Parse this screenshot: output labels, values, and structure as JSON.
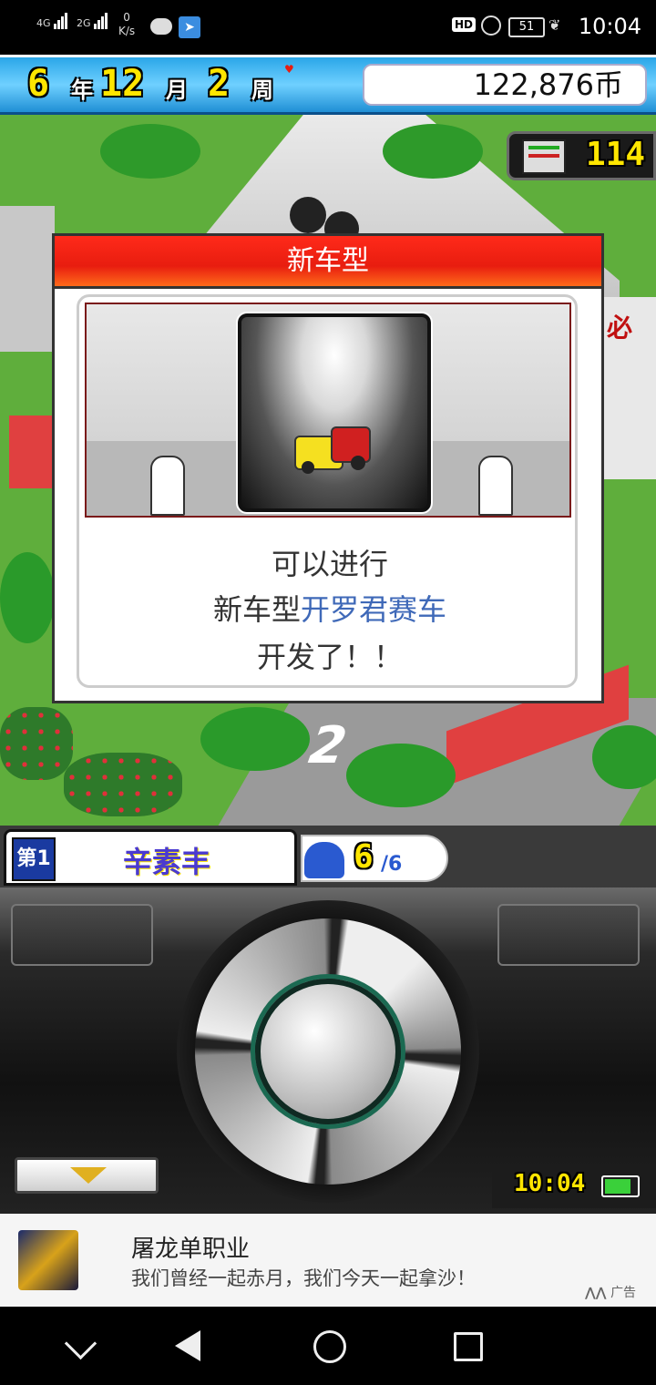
{
  "status_bar": {
    "net1": "4G",
    "net2": "2G",
    "speed_value": "0",
    "speed_unit": "K/s",
    "hd": "HD",
    "battery": "51",
    "time": "10:04"
  },
  "topbar": {
    "year_num": "6",
    "year_label": "年",
    "month_num": "12",
    "month_label": "月",
    "week_num": "2",
    "week_label": "周",
    "money": "122,876币"
  },
  "monitor": {
    "value": "114"
  },
  "dialog": {
    "title": "新车型",
    "line1": "可以进行",
    "line2_prefix": "新车型",
    "line2_highlight": "开罗君赛车",
    "line3": "开发了！！"
  },
  "staff": {
    "badge": "第1",
    "name": "辛素丰",
    "count": "6",
    "total": "/6"
  },
  "controller": {
    "clock": "10:04"
  },
  "ad": {
    "title": "屠龙单职业",
    "subtitle": "我们曾经一起赤月，我们今天一起拿沙！",
    "label": "广告"
  },
  "colors": {
    "accent_red": "#e81d0f",
    "highlight_blue": "#3f69b8",
    "topbar_blue": "#2aa6e8"
  }
}
